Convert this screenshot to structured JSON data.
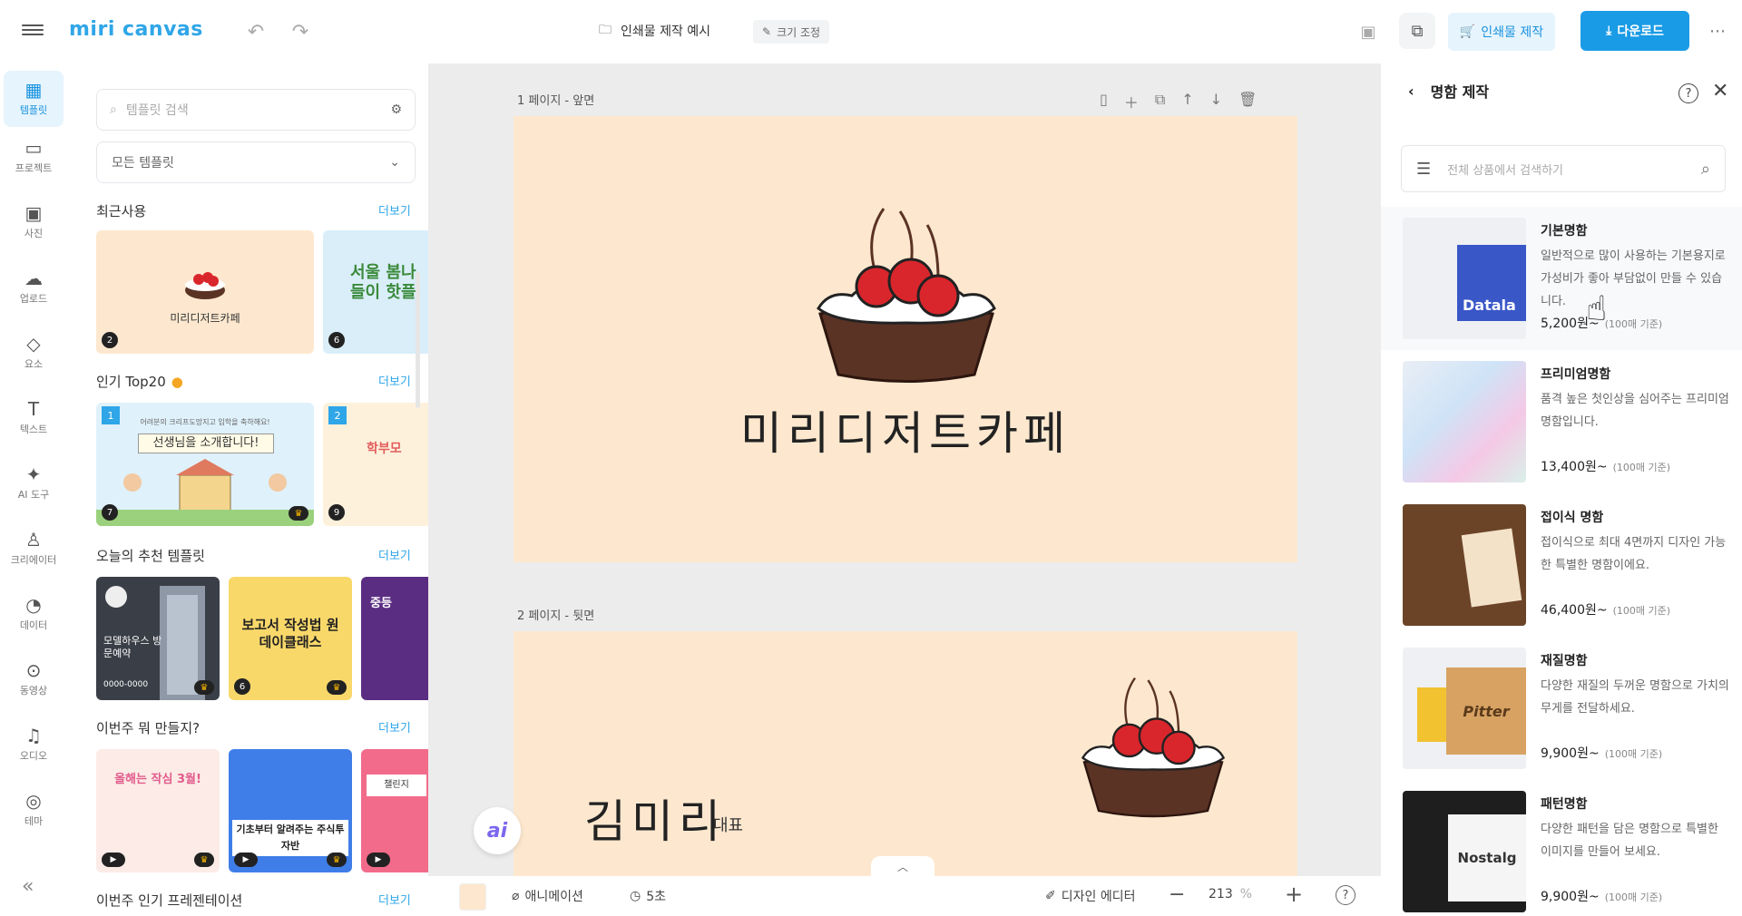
{
  "app": {
    "logo": "miri canvas"
  },
  "header": {
    "doc_title": "인쇄물 제작 예시",
    "resize_label": "크기 조정",
    "print_label": "인쇄물 제작",
    "download_label": "다운로드"
  },
  "rail": {
    "items": [
      {
        "label": "템플릿"
      },
      {
        "label": "프로젝트"
      },
      {
        "label": "사진"
      },
      {
        "label": "업로드"
      },
      {
        "label": "요소"
      },
      {
        "label": "텍스트"
      },
      {
        "label": "AI 도구"
      },
      {
        "label": "크리에이터"
      },
      {
        "label": "데이터"
      },
      {
        "label": "동영상"
      },
      {
        "label": "오디오"
      },
      {
        "label": "테마"
      }
    ]
  },
  "templates": {
    "search_placeholder": "템플릿 검색",
    "filter_value": "모든 템플릿",
    "more": "더보기",
    "sections": [
      {
        "title": "최근사용"
      },
      {
        "title": "인기 Top20"
      },
      {
        "title": "오늘의 추천 템플릿"
      },
      {
        "title": "이번주 뭐 만들지?"
      },
      {
        "title": "이번주 인기 프레젠테이션"
      }
    ],
    "recent": [
      {
        "text": "미리디저트카페",
        "badge": "2"
      },
      {
        "text": "서울 봄나들이 핫플",
        "badge": "6"
      }
    ],
    "top20": [
      {
        "rank": "1",
        "badge": "7",
        "banner": "선생님을 소개합니다!",
        "small": "어려분의 크리프도망지고 입학을 축하해요!"
      },
      {
        "rank": "2",
        "badge": "9",
        "banner": "학부모"
      }
    ],
    "today": [
      {
        "text": "모델하우스 방문예약",
        "badge": "",
        "small": "0000-0000"
      },
      {
        "text": "보고서 작성법 원데이클래스",
        "badge": "6"
      },
      {
        "text": "중등"
      }
    ],
    "week": [
      {
        "text": "올해는 작심 3월!"
      },
      {
        "text": "기초부터 알려주는 주식투자반"
      },
      {
        "text": "챌린지"
      }
    ]
  },
  "canvas": {
    "page1_label": "1 페이지 - 앞면",
    "page2_label": "2 페이지 - 뒷면",
    "page1_title": "미리디저트카페",
    "page2_name": "김미리",
    "page2_role": "대표",
    "ai_label": "ai"
  },
  "bottom": {
    "animation": "애니메이션",
    "duration": "5초",
    "editor": "디자인 에디터",
    "zoom": "213",
    "zoom_unit": "%"
  },
  "right_panel": {
    "title": "명함 제작",
    "search_placeholder": "전체 상품에서 검색하기",
    "products": [
      {
        "name": "기본명함",
        "desc": "일반적으로 많이 사용하는 기본용지로 가성비가 좋아 부담없이 만들 수 있습니다.",
        "price": "5,200원~",
        "note": "(100매 기준)"
      },
      {
        "name": "프리미엄명함",
        "desc": "품격 높은 첫인상을 심어주는 프리미엄 명함입니다.",
        "price": "13,400원~",
        "note": "(100매 기준)"
      },
      {
        "name": "접이식 명함",
        "desc": "접이식으로 최대 4면까지 디자인 가능한 특별한 명함이에요.",
        "price": "46,400원~",
        "note": "(100매 기준)"
      },
      {
        "name": "재질명함",
        "desc": "다양한 재질의 두꺼운 명함으로 가치의 무게를 전달하세요.",
        "price": "9,900원~",
        "note": "(100매 기준)"
      },
      {
        "name": "패턴명함",
        "desc": "다양한 패턴을 담은 명함으로 특별한 이미지를 만들어 보세요.",
        "price": "9,900원~",
        "note": "(100매 기준)"
      }
    ],
    "product_img_text": [
      "Datala",
      "",
      "",
      "Pitter",
      "Nostalg"
    ]
  },
  "colors": {
    "accent": "#1a9be6",
    "canvas_bg": "#fde8cf",
    "cherry": "#d9262c",
    "tart": "#5b3325"
  }
}
